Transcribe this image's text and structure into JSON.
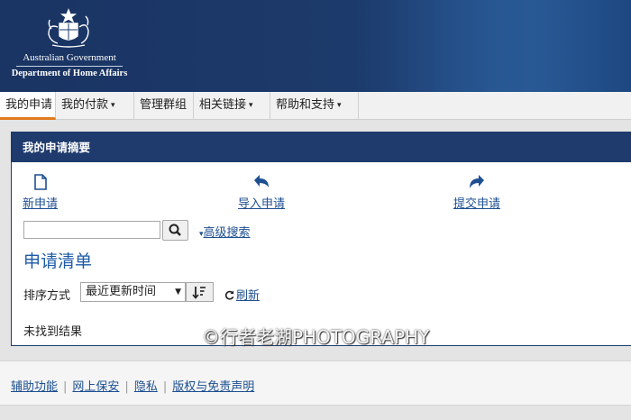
{
  "header": {
    "gov_name": "Australian Government",
    "dept_name": "Department of Home Affairs",
    "crest_icon": "coat-of-arms-icon",
    "colors": {
      "header_bg": "#1c3a6b",
      "accent": "#e07a1e"
    }
  },
  "nav": {
    "items": [
      {
        "label": "我的申请",
        "active": true
      },
      {
        "label": "我的付款",
        "dropdown": true
      },
      {
        "label": "管理群组"
      },
      {
        "label": "相关链接",
        "dropdown": true
      },
      {
        "label": "帮助和支持",
        "dropdown": true
      }
    ],
    "caret": "▾"
  },
  "panel": {
    "title": "我的申请摘要",
    "actions": [
      {
        "label": "新申请",
        "icon": "new-document-icon"
      },
      {
        "label": "导入申请",
        "icon": "import-arrow-icon"
      },
      {
        "label": "提交申请",
        "icon": "share-arrow-icon"
      }
    ],
    "search": {
      "value": "",
      "button_icon": "search-icon",
      "advanced_label": "高级搜索"
    },
    "list_title": "申请清单",
    "sort": {
      "label": "排序方式",
      "selected": "最近更新时间",
      "order_icon": "sort-order-icon"
    },
    "refresh_label": "刷新",
    "empty_message": "未找到结果"
  },
  "watermark": "©行者老湖PHOTOGRAPHY",
  "footer": {
    "links": [
      "辅助功能",
      "网上保安",
      "隐私",
      "版权与免责声明"
    ]
  }
}
